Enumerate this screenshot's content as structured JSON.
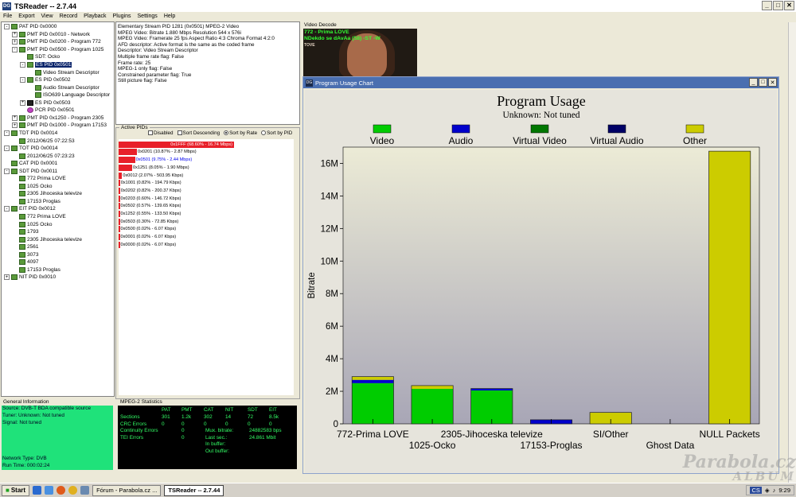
{
  "window": {
    "title": "TSReader -- 2.7.44",
    "icon_label": "DG"
  },
  "menu": [
    "File",
    "Export",
    "View",
    "Record",
    "Playback",
    "Plugins",
    "Settings",
    "Help"
  ],
  "tree": [
    {
      "label": "PAT PID 0x0000",
      "indent": 0,
      "box": "-",
      "icon": "green"
    },
    {
      "label": "PMT PID 0x0010 - Network",
      "indent": 1,
      "box": "+",
      "icon": "green"
    },
    {
      "label": "PMT PID 0x0200 - Program 772",
      "indent": 1,
      "box": "+",
      "icon": "green"
    },
    {
      "label": "PMT PID 0x0500 - Program 1025",
      "indent": 1,
      "box": "-",
      "icon": "green"
    },
    {
      "label": "SDT: Ocko",
      "indent": 2,
      "box": "",
      "icon": "green"
    },
    {
      "label": "ES PID 0x0501",
      "indent": 2,
      "box": "-",
      "icon": "green",
      "selected": true
    },
    {
      "label": "Video Stream Descriptor",
      "indent": 3,
      "box": "",
      "icon": "green"
    },
    {
      "label": "ES PID 0x0502",
      "indent": 2,
      "box": "-",
      "icon": "green"
    },
    {
      "label": "Audio Stream Descriptor",
      "indent": 3,
      "box": "",
      "icon": "green"
    },
    {
      "label": "ISO639 Language Descriptor",
      "indent": 3,
      "box": "",
      "icon": "green"
    },
    {
      "label": "ES PID 0x0503",
      "indent": 2,
      "box": "+",
      "icon": "black"
    },
    {
      "label": "PCR PID 0x0501",
      "indent": 2,
      "box": "",
      "icon": "pcr"
    },
    {
      "label": "PMT PID 0x1250 - Program 2305",
      "indent": 1,
      "box": "+",
      "icon": "green"
    },
    {
      "label": "PMT PID 0x1000 - Program 17153",
      "indent": 1,
      "box": "+",
      "icon": "green"
    },
    {
      "label": "TDT PID 0x0014",
      "indent": 0,
      "box": "-",
      "icon": "green"
    },
    {
      "label": "2012/06/25 07:22:53",
      "indent": 1,
      "box": "",
      "icon": "green"
    },
    {
      "label": "TOT PID 0x0014",
      "indent": 0,
      "box": "-",
      "icon": "green"
    },
    {
      "label": "2012/06/25 07:23:23",
      "indent": 1,
      "box": "",
      "icon": "green"
    },
    {
      "label": "CAT PID 0x0001",
      "indent": 0,
      "box": "",
      "icon": "green"
    },
    {
      "label": "SDT PID 0x0011",
      "indent": 0,
      "box": "-",
      "icon": "green"
    },
    {
      "label": "772 Prima LOVE",
      "indent": 1,
      "box": "",
      "icon": "green"
    },
    {
      "label": "1025 Ocko",
      "indent": 1,
      "box": "",
      "icon": "green"
    },
    {
      "label": "2305 Jihoceska televize",
      "indent": 1,
      "box": "",
      "icon": "green"
    },
    {
      "label": "17153 Proglas",
      "indent": 1,
      "box": "",
      "icon": "green"
    },
    {
      "label": "EIT PID 0x0012",
      "indent": 0,
      "box": "-",
      "icon": "green"
    },
    {
      "label": "772 Prima LOVE",
      "indent": 1,
      "box": "",
      "icon": "green"
    },
    {
      "label": "1025 Ocko",
      "indent": 1,
      "box": "",
      "icon": "green"
    },
    {
      "label": "1793",
      "indent": 1,
      "box": "",
      "icon": "green"
    },
    {
      "label": "2305 Jihoceska televize",
      "indent": 1,
      "box": "",
      "icon": "green"
    },
    {
      "label": "2561",
      "indent": 1,
      "box": "",
      "icon": "green"
    },
    {
      "label": "3073",
      "indent": 1,
      "box": "",
      "icon": "green"
    },
    {
      "label": "4097",
      "indent": 1,
      "box": "",
      "icon": "green"
    },
    {
      "label": "17153 Proglas",
      "indent": 1,
      "box": "",
      "icon": "green"
    },
    {
      "label": "NIT PID 0x0010",
      "indent": 0,
      "box": "+",
      "icon": "green"
    }
  ],
  "info_lines": [
    "Elementary Stream PID 1281 (0x0501) MPEG-2 Video",
    "MPEG Video: Bitrate 1.880 Mbps Resolution 544 x 576i",
    "MPEG Video: Framerate 25 fps Aspect Ratio 4:3 Chroma Format 4:2:0",
    "AFD descriptor: Active format is the same as the coded frame",
    "Descriptor: Video Stream Descriptor",
    "Multiple frame rate flag: False",
    "Frame rate: 25",
    "MPEG-1 only flag: False",
    "Constrained parameter flag: True",
    "Still picture flag: False"
  ],
  "active_pids": {
    "legend": "Active PIDs",
    "disabled_label": "Disabled",
    "sort_desc_label": "Sort Descending",
    "sort_rate_label": "Sort by Rate",
    "sort_pid_label": "Sort by PID",
    "rows": [
      {
        "text": "0x1FFF (68.60% - 16.74 Mbps)",
        "pct": 68.6
      },
      {
        "text": "0x0201 (10.87% - 2.87 Mbps)",
        "pct": 10.87
      },
      {
        "text": "0x0501 (9.75% - 2.44 Mbps)",
        "pct": 9.75,
        "selected": true
      },
      {
        "text": "0x1251 (8.05% - 1.90 Mbps)",
        "pct": 8.05
      },
      {
        "text": "0x0012 (2.07% - 503.95 Kbps)",
        "pct": 2.07
      },
      {
        "text": "0x1001 (0.82% - 194.79 Kbps)",
        "pct": 0.82
      },
      {
        "text": "0x0202 (0.82% - 200.37 Kbps)",
        "pct": 0.82
      },
      {
        "text": "0x0203 (0.60% - 146.72 Kbps)",
        "pct": 0.6
      },
      {
        "text": "0x0502 (0.57% - 139.65 Kbps)",
        "pct": 0.57
      },
      {
        "text": "0x1252 (0.55% - 133.50 Kbps)",
        "pct": 0.55
      },
      {
        "text": "0x0503 (0.30% - 72.85 Kbps)",
        "pct": 0.3
      },
      {
        "text": "0x0500 (0.02% - 6.07 Kbps)",
        "pct": 0.02
      },
      {
        "text": "0x0001 (0.02% - 6.07 Kbps)",
        "pct": 0.02
      },
      {
        "text": "0x0000 (0.02% - 6.07 Kbps)",
        "pct": 0.02
      }
    ]
  },
  "general_info": {
    "legend": "General Information",
    "rows": [
      "Source: DVB-T BDA compatible source",
      "Tuner: Unknown: Not tuned",
      "Signal: Not tuned",
      "",
      "",
      "",
      "",
      "Network Type: DVB",
      "Run Time: 000:02:24"
    ]
  },
  "mpeg_stats": {
    "legend": "MPEG-2 Statistics",
    "headers": [
      "PAT",
      "PMT",
      "CAT",
      "NIT",
      "SDT",
      "EIT"
    ],
    "row_labels": [
      "Sections",
      "CRC Errors",
      "Continuity Errors",
      "TEI Errors"
    ],
    "sections": [
      "301",
      "1.2k",
      "302",
      "14",
      "72",
      "8.5k"
    ],
    "crc": [
      "0",
      "0",
      "0",
      "0",
      "0",
      "0"
    ],
    "continuity": "0",
    "tei": "0",
    "mux_label": "Mux. bitrate:",
    "mux_value": "24882583 bps",
    "last_sec_label": "Last sec.:",
    "last_sec_value": "24.861 Mbit",
    "in_buffer_label": "In buffer:",
    "out_buffer_label": "Out buffer:"
  },
  "video_decode": {
    "legend": "Video Decode",
    "line1": "772 - Prima LOVE",
    "line2": "NDekdo se dAvAa (58) -ST -W",
    "line3": "TOVE"
  },
  "chart_window": {
    "title": "Program Usage Chart",
    "icon_label": "DG"
  },
  "chart_data": {
    "type": "bar",
    "title": "Program Usage",
    "subtitle": "Unknown: Not tuned",
    "ylabel": "Bitrate",
    "xlabel": "",
    "ylim": [
      0,
      17000000
    ],
    "yticks": [
      0,
      2000000,
      4000000,
      6000000,
      8000000,
      10000000,
      12000000,
      14000000,
      16000000
    ],
    "ytick_labels": [
      "0",
      "2M",
      "4M",
      "6M",
      "8M",
      "10M",
      "12M",
      "14M",
      "16M"
    ],
    "categories": [
      "772-Prima LOVE",
      "1025-Ocko",
      "2305-Jihoceska televize",
      "17153-Proglas",
      "SI/Other",
      "Ghost Data",
      "NULL Packets"
    ],
    "label_row": [
      0,
      1,
      0,
      1,
      0,
      1,
      0
    ],
    "series": [
      {
        "name": "Video",
        "color": "#00cc00",
        "values": [
          2500000,
          2150000,
          2050000,
          0,
          0,
          0,
          0
        ]
      },
      {
        "name": "Audio",
        "color": "#0000cc",
        "values": [
          200000,
          0,
          120000,
          250000,
          0,
          0,
          0
        ]
      },
      {
        "name": "Virtual Video",
        "color": "#007700",
        "values": [
          0,
          0,
          0,
          0,
          0,
          0,
          0
        ]
      },
      {
        "name": "Virtual Audio",
        "color": "#000066",
        "values": [
          0,
          0,
          0,
          0,
          0,
          0,
          0
        ]
      },
      {
        "name": "Other",
        "color": "#cccc00",
        "values": [
          200000,
          200000,
          0,
          0,
          700000,
          0,
          16750000
        ]
      }
    ],
    "legend_position": "top",
    "grid": false
  },
  "taskbar": {
    "start_label": "Start",
    "tasks": [
      {
        "label": "Fórum - Parabola.cz ...",
        "active": false
      },
      {
        "label": "TSReader -- 2.7.44",
        "active": true
      }
    ],
    "clock": "9:29",
    "lang": "CS"
  },
  "watermark": {
    "line1": "Parabola.cz",
    "line2": "ALBUM"
  }
}
